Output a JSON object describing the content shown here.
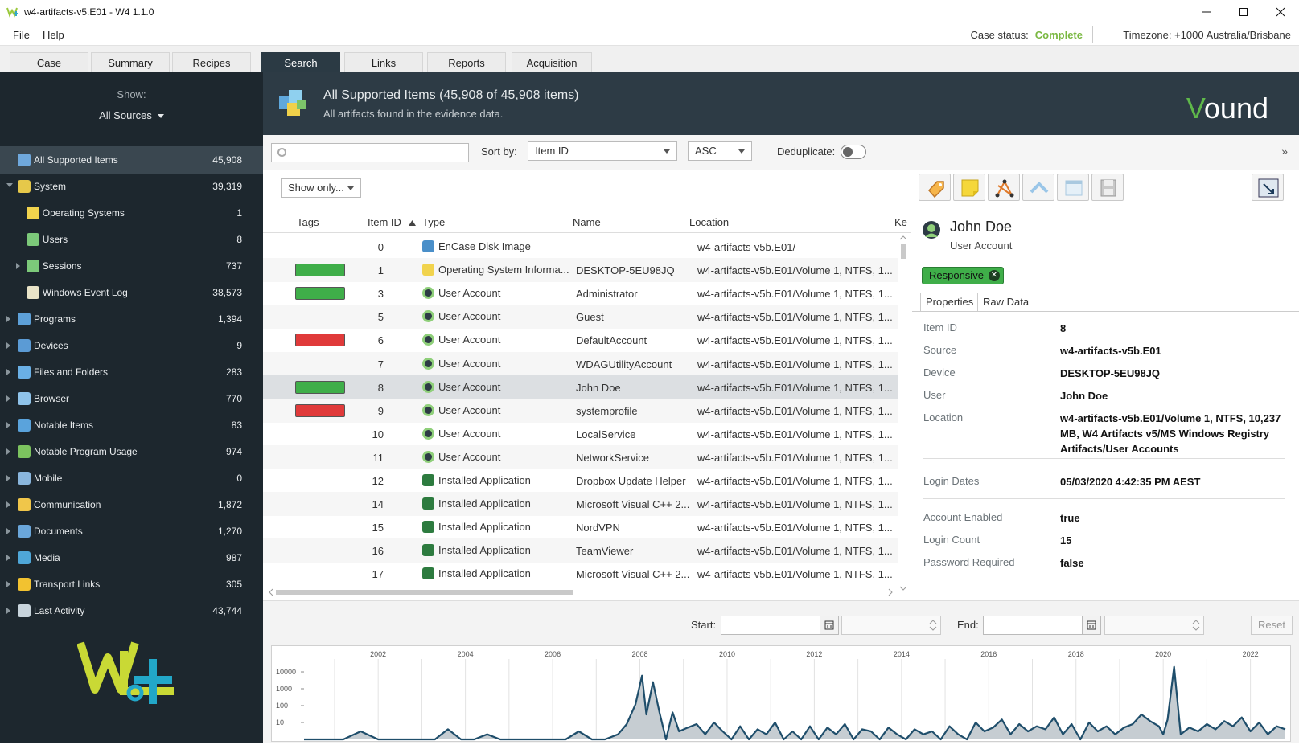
{
  "window": {
    "title": "w4-artifacts-v5.E01 - W4 1.1.0"
  },
  "menu": [
    "File",
    "Help"
  ],
  "case_status": {
    "label": "Case status:",
    "value": "Complete"
  },
  "timezone": "Timezone: +1000 Australia/Brisbane",
  "tabs": [
    "Case",
    "Summary",
    "Recipes",
    "Search",
    "Links",
    "Reports",
    "Acquisition"
  ],
  "active_tab": "Search",
  "sidebar": {
    "show_label": "Show:",
    "source": "All Sources",
    "categories": [
      {
        "label": "All Supported Items",
        "count": "45,908",
        "icon": "cube-icon",
        "color": "#6fa8dc"
      },
      {
        "label": "System",
        "count": "39,319",
        "icon": "system-icon",
        "color": "#e6c84a"
      },
      {
        "label": "Operating Systems",
        "count": "1",
        "icon": "os-icon",
        "color": "#f1d34d"
      },
      {
        "label": "Users",
        "count": "8",
        "icon": "user-icon",
        "color": "#7cc97a"
      },
      {
        "label": "Sessions",
        "count": "737",
        "icon": "session-icon",
        "color": "#7cc97a"
      },
      {
        "label": "Windows Event Log",
        "count": "38,573",
        "icon": "event-log-icon",
        "color": "#e9e4c8"
      },
      {
        "label": "Programs",
        "count": "1,394",
        "icon": "programs-icon",
        "color": "#5da0d8"
      },
      {
        "label": "Devices",
        "count": "9",
        "icon": "devices-icon",
        "color": "#5b9bd5"
      },
      {
        "label": "Files and Folders",
        "count": "283",
        "icon": "folder-icon",
        "color": "#6ab0e6"
      },
      {
        "label": "Browser",
        "count": "770",
        "icon": "browser-icon",
        "color": "#8fc3ea"
      },
      {
        "label": "Notable Items",
        "count": "83",
        "icon": "notable-icon",
        "color": "#5aa3dc"
      },
      {
        "label": "Notable Program Usage",
        "count": "974",
        "icon": "program-usage-icon",
        "color": "#7cc35f"
      },
      {
        "label": "Mobile",
        "count": "0",
        "icon": "mobile-icon",
        "color": "#8ab6dd"
      },
      {
        "label": "Communication",
        "count": "1,872",
        "icon": "communication-icon",
        "color": "#f0c64a"
      },
      {
        "label": "Documents",
        "count": "1,270",
        "icon": "documents-icon",
        "color": "#6aa6da"
      },
      {
        "label": "Media",
        "count": "987",
        "icon": "media-icon",
        "color": "#4fa7d8"
      },
      {
        "label": "Transport Links",
        "count": "305",
        "icon": "transport-icon",
        "color": "#f2c230"
      },
      {
        "label": "Last Activity",
        "count": "43,744",
        "icon": "last-activity-icon",
        "color": "#c8d4dc"
      }
    ]
  },
  "header": {
    "title": "All Supported Items (45,908 of 45,908 items)",
    "subtitle": "All artifacts found in the evidence data.",
    "brand": "Vound"
  },
  "toolbar": {
    "search_placeholder": "",
    "sort_label": "Sort by:",
    "sort_field": "Item ID",
    "sort_order": "ASC",
    "dedup_label": "Deduplicate:",
    "expand": "»"
  },
  "list": {
    "show_only": "Show only...",
    "columns": [
      "Tags",
      "Item ID",
      "Type",
      "Name",
      "Location",
      "Ke"
    ],
    "rows": [
      {
        "tag": "",
        "id": "0",
        "type": "EnCase Disk Image",
        "icon": "disk-image-icon",
        "name": "",
        "location": "w4-artifacts-v5b.E01/"
      },
      {
        "tag": "green",
        "id": "1",
        "type": "Operating System Informa...",
        "icon": "os-icon",
        "name": "DESKTOP-5EU98JQ",
        "location": "w4-artifacts-v5b.E01/Volume 1, NTFS, 1..."
      },
      {
        "tag": "green",
        "id": "3",
        "type": "User Account",
        "icon": "user-icon",
        "name": "Administrator",
        "location": "w4-artifacts-v5b.E01/Volume 1, NTFS, 1..."
      },
      {
        "tag": "",
        "id": "5",
        "type": "User Account",
        "icon": "user-icon",
        "name": "Guest",
        "location": "w4-artifacts-v5b.E01/Volume 1, NTFS, 1..."
      },
      {
        "tag": "red",
        "id": "6",
        "type": "User Account",
        "icon": "user-icon",
        "name": "DefaultAccount",
        "location": "w4-artifacts-v5b.E01/Volume 1, NTFS, 1..."
      },
      {
        "tag": "",
        "id": "7",
        "type": "User Account",
        "icon": "user-icon",
        "name": "WDAGUtilityAccount",
        "location": "w4-artifacts-v5b.E01/Volume 1, NTFS, 1..."
      },
      {
        "tag": "green",
        "id": "8",
        "type": "User Account",
        "icon": "user-icon",
        "name": "John Doe",
        "location": "w4-artifacts-v5b.E01/Volume 1, NTFS, 1...",
        "selected": true
      },
      {
        "tag": "red",
        "id": "9",
        "type": "User Account",
        "icon": "user-icon",
        "name": "systemprofile",
        "location": "w4-artifacts-v5b.E01/Volume 1, NTFS, 1..."
      },
      {
        "tag": "",
        "id": "10",
        "type": "User Account",
        "icon": "user-icon",
        "name": "LocalService",
        "location": "w4-artifacts-v5b.E01/Volume 1, NTFS, 1..."
      },
      {
        "tag": "",
        "id": "11",
        "type": "User Account",
        "icon": "user-icon",
        "name": "NetworkService",
        "location": "w4-artifacts-v5b.E01/Volume 1, NTFS, 1..."
      },
      {
        "tag": "",
        "id": "12",
        "type": "Installed Application",
        "icon": "app-icon",
        "name": "Dropbox Update Helper",
        "location": "w4-artifacts-v5b.E01/Volume 1, NTFS, 1..."
      },
      {
        "tag": "",
        "id": "14",
        "type": "Installed Application",
        "icon": "app-icon",
        "name": "Microsoft Visual C++ 2...",
        "location": "w4-artifacts-v5b.E01/Volume 1, NTFS, 1..."
      },
      {
        "tag": "",
        "id": "15",
        "type": "Installed Application",
        "icon": "app-icon",
        "name": "NordVPN",
        "location": "w4-artifacts-v5b.E01/Volume 1, NTFS, 1..."
      },
      {
        "tag": "",
        "id": "16",
        "type": "Installed Application",
        "icon": "app-icon",
        "name": "TeamViewer",
        "location": "w4-artifacts-v5b.E01/Volume 1, NTFS, 1..."
      },
      {
        "tag": "",
        "id": "17",
        "type": "Installed Application",
        "icon": "app-icon",
        "name": "Microsoft Visual C++ 2...",
        "location": "w4-artifacts-v5b.E01/Volume 1, NTFS, 1..."
      }
    ]
  },
  "detail": {
    "name": "John Doe",
    "type": "User Account",
    "badge": "Responsive",
    "tabs": [
      "Properties",
      "Raw Data"
    ],
    "properties": [
      {
        "label": "Item ID",
        "value": "8"
      },
      {
        "label": "Source",
        "value": "w4-artifacts-v5b.E01"
      },
      {
        "label": "Device",
        "value": "DESKTOP-5EU98JQ"
      },
      {
        "label": "User",
        "value": "John Doe"
      },
      {
        "label": "Location",
        "value": "w4-artifacts-v5b.E01/Volume 1, NTFS, 10,237 MB, W4 Artifacts v5/MS Windows Registry Artifacts/User Accounts"
      },
      {
        "label": "Login Dates",
        "value": "05/03/2020 4:42:35 PM AEST"
      },
      {
        "label": "Account Enabled",
        "value": "true"
      },
      {
        "label": "Login Count",
        "value": "15"
      },
      {
        "label": "Password Required",
        "value": "false"
      }
    ]
  },
  "timeline": {
    "start_label": "Start:",
    "end_label": "End:",
    "reset_label": "Reset"
  },
  "chart_data": {
    "type": "area",
    "title": "",
    "xlabel": "",
    "ylabel": "",
    "x_ticks": [
      "2002",
      "2004",
      "2006",
      "2008",
      "2010",
      "2012",
      "2014",
      "2016",
      "2018",
      "2020",
      "2022"
    ],
    "y_ticks": [
      "10",
      "100",
      "1000",
      "10000"
    ],
    "yscale": "log",
    "xlim": [
      2000.3,
      2022.8
    ],
    "ylim": [
      1,
      30000
    ],
    "color": "#1f4e6b",
    "fill": "#c6cdd2",
    "series": [
      {
        "x": [
          2000.3,
          2000.8,
          2001.2,
          2001.6,
          2002.0,
          2002.4,
          2002.7,
          2003.0,
          2003.3,
          2003.6,
          2003.9,
          2004.2,
          2004.5,
          2004.8,
          2005.1,
          2005.4,
          2005.7,
          2006.0,
          2006.3,
          2006.6,
          2006.9,
          2007.2,
          2007.5,
          2007.7,
          2007.9,
          2008.05,
          2008.15,
          2008.3,
          2008.45,
          2008.6,
          2008.75,
          2008.9,
          2009.1,
          2009.3,
          2009.5,
          2009.7,
          2009.9,
          2010.1,
          2010.3,
          2010.5,
          2010.7,
          2010.9,
          2011.1,
          2011.3,
          2011.5,
          2011.7,
          2011.9,
          2012.1,
          2012.3,
          2012.5,
          2012.7,
          2012.9,
          2013.1,
          2013.3,
          2013.5,
          2013.7,
          2013.9,
          2014.1,
          2014.3,
          2014.5,
          2014.7,
          2014.9,
          2015.1,
          2015.3,
          2015.5,
          2015.7,
          2015.9,
          2016.1,
          2016.3,
          2016.5,
          2016.7,
          2016.9,
          2017.1,
          2017.3,
          2017.5,
          2017.7,
          2017.9,
          2018.1,
          2018.3,
          2018.5,
          2018.7,
          2018.9,
          2019.1,
          2019.3,
          2019.5,
          2019.7,
          2019.9,
          2020.0,
          2020.1,
          2020.25,
          2020.4,
          2020.6,
          2020.8,
          2021.0,
          2021.2,
          2021.4,
          2021.6,
          2021.8,
          2022.0,
          2022.2,
          2022.4,
          2022.6,
          2022.8
        ],
        "y": [
          1,
          1,
          1,
          3,
          1,
          1,
          1,
          1,
          1,
          4,
          1,
          1,
          2,
          1,
          1,
          1,
          1,
          1,
          1,
          3,
          1,
          1,
          2,
          8,
          120,
          6000,
          30,
          2500,
          40,
          1,
          40,
          3,
          5,
          8,
          2,
          10,
          3,
          1,
          6,
          1,
          4,
          2,
          10,
          1,
          3,
          1,
          6,
          1,
          5,
          2,
          8,
          1,
          4,
          3,
          1,
          5,
          2,
          1,
          4,
          2,
          3,
          1,
          6,
          2,
          1,
          10,
          3,
          5,
          15,
          2,
          8,
          3,
          6,
          4,
          20,
          2,
          8,
          1,
          10,
          3,
          6,
          2,
          5,
          8,
          30,
          12,
          6,
          2,
          15,
          20000,
          2,
          5,
          3,
          8,
          4,
          12,
          6,
          20,
          3,
          10,
          2,
          6,
          4
        ]
      }
    ]
  }
}
